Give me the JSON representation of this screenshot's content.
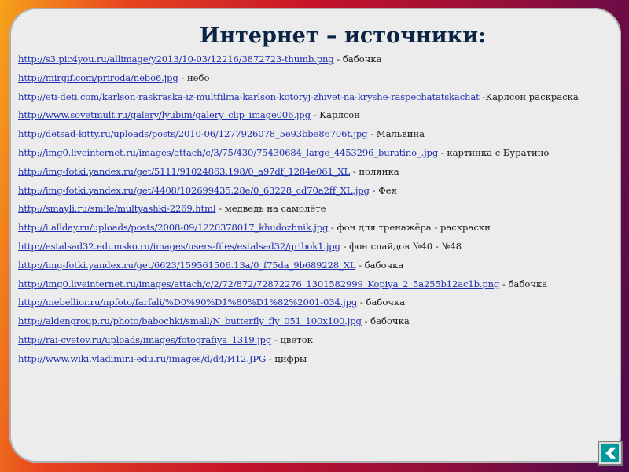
{
  "slide": {
    "title": "Интернет – источники:",
    "items": [
      {
        "url": "http://s3.pic4you.ru/allimage/y2013/10-03/12216/3872723-thumb.png",
        "desc": " - бабочка"
      },
      {
        "url": "http://mirgif.com/priroda/nebo6.jpg",
        "desc": " - небо"
      },
      {
        "url": "http://eti-deti.com/karlson-raskraska-iz-multfilma-karlson-kotoryj-zhivet-na-kryshe-raspechatatskachat",
        "desc": " -Карлсон раскраска"
      },
      {
        "url": "http://www.sovetmult.ru/galery/lyubim/galery_clip_image006.jpg",
        "desc": " - Карлсон"
      },
      {
        "url": "http://detsad-kitty.ru/uploads/posts/2010-06/1277926078_5e93bbe86706t.jpg",
        "desc": " - Мальвина"
      },
      {
        "url": "http://img0.liveinternet.ru/images/attach/c/3/75/430/75430684_large_4453296_buratino_.jpg",
        "desc": " - картинка с Буратино"
      },
      {
        "url": "http://img-fotki.yandex.ru/get/5111/91024863.198/0_a97df_1284e061_XL",
        "desc": " - полянка"
      },
      {
        "url": "http://img-fotki.yandex.ru/get/4408/102699435.28e/0_63228_cd70a2ff_XL.jpg",
        "desc": " - Фея"
      },
      {
        "url": "http://smayli.ru/smile/multyashki-2269.html",
        "desc": "  - медведь на самолёте"
      },
      {
        "url": "http://i.allday.ru/uploads/posts/2008-09/1220378017_khudozhnik.jpg",
        "desc": " - фон для тренажёра  - раскраски"
      },
      {
        "url": "http://estalsad32.edumsko.ru/images/users-files/estalsad32/gribok1.jpg",
        "desc": "  - фон слайдов №40 - №48"
      },
      {
        "url": "http://img-fotki.yandex.ru/get/6623/159561506.13a/0_f75da_9b689228_XL",
        "desc": " - бабочка"
      },
      {
        "url": "http://img0.liveinternet.ru/images/attach/c/2/72/872/72872276_1301582999_Kopiya_2_5a255b12ac1b.png",
        "desc": " - бабочка"
      },
      {
        "url": "http://mebellior.ru/npfoto/farfali/%D0%90%D1%80%D1%82%2001-034.jpg",
        "desc": " - бабочка"
      },
      {
        "url": "http://aldengroup.ru/photo/babochki/small/N_butterfly_fly_051_100x100.jpg",
        "desc": " - бабочка"
      },
      {
        "url": "http://rai-cvetov.ru/uploads/images/fotografiya_1319.jpg",
        "desc": " - цветок"
      },
      {
        "url": "http://www.wiki.vladimir.i-edu.ru/images/d/d4/И12.JPG",
        "desc": " - цифры"
      }
    ]
  },
  "nav": {
    "icon": "return-icon",
    "accent": "#009a9a"
  }
}
